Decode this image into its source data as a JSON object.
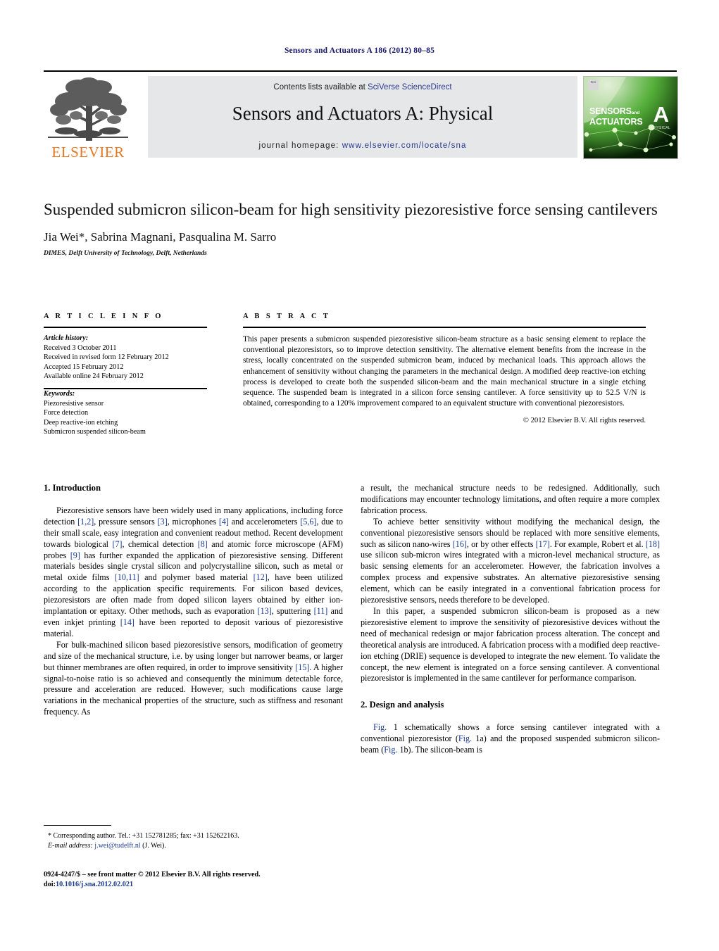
{
  "running_head": "Sensors and Actuators A 186 (2012) 80–85",
  "masthead": {
    "contents_prefix": "Contents lists available at ",
    "contents_link": "SciVerse ScienceDirect",
    "journal_title": "Sensors and Actuators A: Physical",
    "homepage_prefix": "journal homepage: ",
    "homepage_link": "www.elsevier.com/locate/sna",
    "publisher": "ELSEVIER",
    "cover": {
      "line1": "SENSORS",
      "line1_small": "and",
      "line2": "ACTUATORS",
      "letter": "A",
      "sub": "PHYSICAL"
    }
  },
  "article": {
    "title": "Suspended submicron silicon-beam for high sensitivity piezoresistive force sensing cantilevers",
    "authors": "Jia Wei*, Sabrina Magnani, Pasqualina M. Sarro",
    "affiliation": "DIMES, Delft University of Technology, Delft, Netherlands"
  },
  "info": {
    "heading": "A R T I C L E   I N F O",
    "history_label": "Article history:",
    "history": [
      "Received 3 October 2011",
      "Received in revised form 12 February 2012",
      "Accepted 15 February 2012",
      "Available online 24 February 2012"
    ],
    "keywords_label": "Keywords:",
    "keywords": [
      "Piezoresistive sensor",
      "Force detection",
      "Deep reactive-ion etching",
      "Submicron suspended silicon-beam"
    ]
  },
  "abstract": {
    "heading": "A B S T R A C T",
    "text": "This paper presents a submicron suspended piezoresistive silicon-beam structure as a basic sensing element to replace the conventional piezoresistors, so to improve detection sensitivity. The alternative element benefits from the increase in the stress, locally concentrated on the suspended submicron beam, induced by mechanical loads. This approach allows the enhancement of sensitivity without changing the parameters in the mechanical design. A modified deep reactive-ion etching process is developed to create both the suspended silicon-beam and the main mechanical structure in a single etching sequence. The suspended beam is integrated in a silicon force sensing cantilever. A force sensitivity up to 52.5 V/N is obtained, corresponding to a 120% improvement compared to an equivalent structure with conventional piezoresistors.",
    "copyright": "© 2012 Elsevier B.V. All rights reserved."
  },
  "body": {
    "section1_heading": "1.  Introduction",
    "section2_heading": "2.  Design and analysis",
    "left_paragraphs": [
      "Piezoresistive sensors have been widely used in many applications, including force detection [1,2], pressure sensors [3], microphones [4] and accelerometers [5,6], due to their small scale, easy integration and convenient readout method. Recent development towards biological [7], chemical detection [8] and atomic force microscope (AFM) probes [9] has further expanded the application of piezoresistive sensing. Different materials besides single crystal silicon and polycrystalline silicon, such as metal or metal oxide films [10,11] and polymer based material [12], have been utilized according to the application specific requirements. For silicon based devices, piezoresistors are often made from doped silicon layers obtained by either ion-implantation or epitaxy. Other methods, such as evaporation [13], sputtering [11] and even inkjet printing [14] have been reported to deposit various of piezoresistive material.",
      "For bulk-machined silicon based piezoresistive sensors, modification of geometry and size of the mechanical structure, i.e. by using longer but narrower beams, or larger but thinner membranes are often required, in order to improve sensitivity [15]. A higher signal-to-noise ratio is so achieved and consequently the minimum detectable force, pressure and acceleration are reduced. However, such modifications cause large variations in the mechanical properties of the structure, such as stiffness and resonant frequency. As"
    ],
    "right_paragraphs": [
      "a result, the mechanical structure needs to be redesigned. Additionally, such modifications may encounter technology limitations, and often require a more complex fabrication process.",
      "To achieve better sensitivity without modifying the mechanical design, the conventional piezoresistive sensors should be replaced with more sensitive elements, such as silicon nano-wires [16], or by other effects [17]. For example, Robert et al. [18] use silicon sub-micron wires integrated with a micron-level mechanical structure, as basic sensing elements for an accelerometer. However, the fabrication involves a complex process and expensive substrates. An alternative piezoresistive sensing element, which can be easily integrated in a conventional fabrication process for piezoresistive sensors, needs therefore to be developed.",
      "In this paper, a suspended submicron silicon-beam is proposed as a new piezoresistive element to improve the sensitivity of piezoresistive devices without the need of mechanical redesign or major fabrication process alteration. The concept and theoretical analysis are introduced. A fabrication process with a modified deep reactive-ion etching (DRIE) sequence is developed to integrate the new element. To validate the concept, the new element is integrated on a force sensing cantilever. A conventional piezoresistor is implemented in the same cantilever for performance comparison.",
      "Fig. 1 schematically shows a force sensing cantilever integrated with a conventional piezoresistor (Fig. 1a) and the proposed suspended submicron silicon-beam (Fig. 1b). The silicon-beam is"
    ]
  },
  "footer": {
    "corresponding": "*  Corresponding author. Tel.: +31 152781285; fax: +31 152622163.",
    "email_label": "E-mail address:",
    "email": "j.wei@tudelft.nl",
    "email_suffix": "(J. Wei).",
    "imprint": "0924-4247/$ – see front matter © 2012 Elsevier B.V. All rights reserved.",
    "doi_label": "doi:",
    "doi": "10.1016/j.sna.2012.02.021"
  },
  "colors": {
    "link": "#1a3a8f",
    "elsevier_orange": "#e87722",
    "banner_gray": "#e6e7e8",
    "running_head": "#15166b"
  }
}
